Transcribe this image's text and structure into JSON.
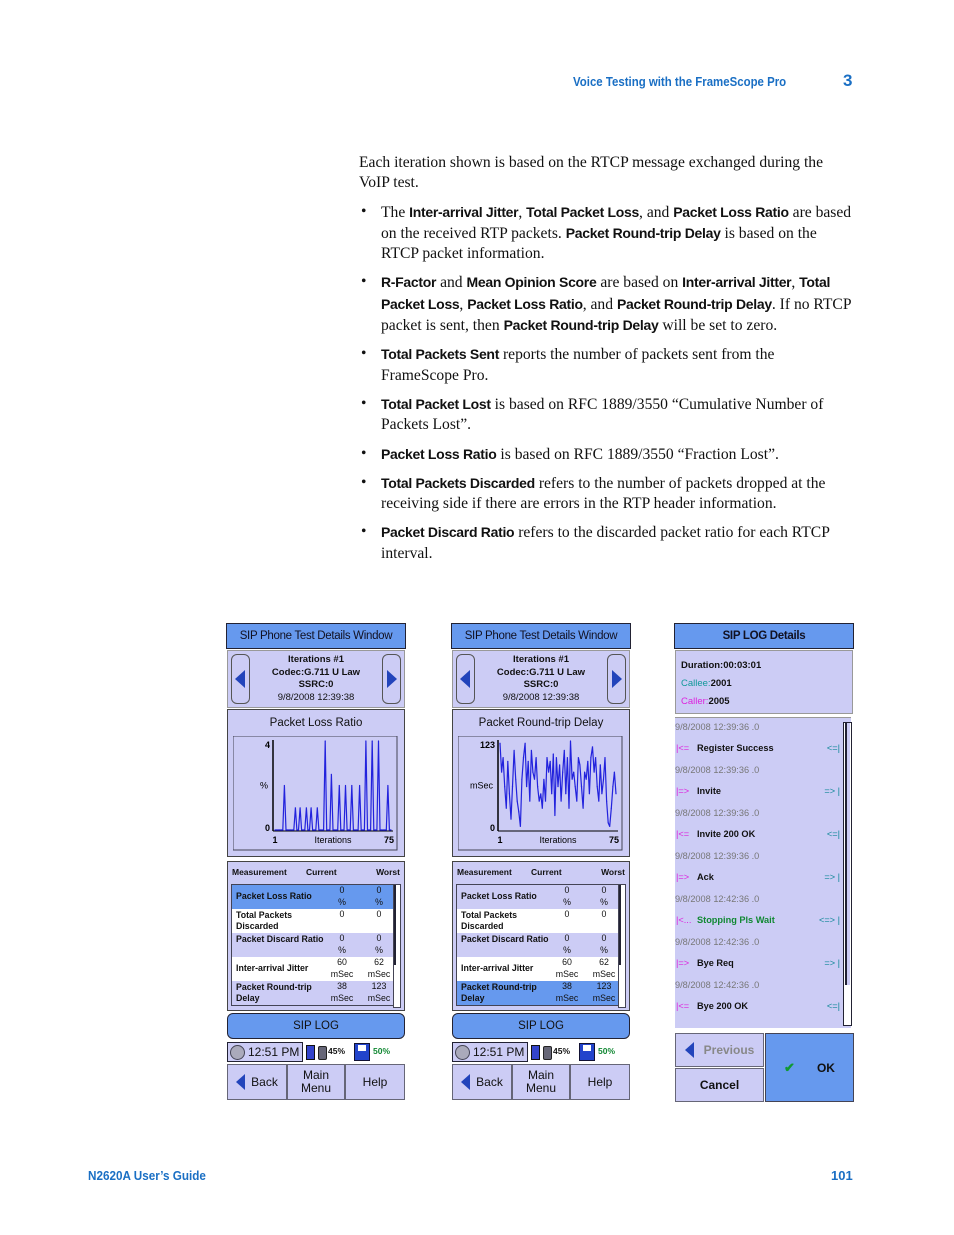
{
  "header": {
    "section_title": "Voice Testing with the FrameScope Pro",
    "chapter_number": "3"
  },
  "body": {
    "intro": "Each iteration shown is based on the RTCP message exchanged during the VoIP test.",
    "bullets": [
      [
        {
          "t": "The "
        },
        {
          "b": "Inter-arrival Jitter"
        },
        {
          "t": ", "
        },
        {
          "b": "Total Packet Loss"
        },
        {
          "t": ", and "
        },
        {
          "b": "Packet Loss Ratio"
        },
        {
          "t": " are based on the received RTP packets. "
        },
        {
          "b": "Packet Round-trip Delay"
        },
        {
          "t": " is based on the RTCP packet information."
        }
      ],
      [
        {
          "b": "R-Factor"
        },
        {
          "t": " and "
        },
        {
          "b": "Mean Opinion Score"
        },
        {
          "t": " are based on "
        },
        {
          "b": "Inter-arrival Jitter"
        },
        {
          "t": ", "
        },
        {
          "b": "Total Packet Loss"
        },
        {
          "t": ", "
        },
        {
          "b": "Packet Loss Ratio"
        },
        {
          "t": ", and "
        },
        {
          "b": "Packet Round-trip Delay"
        },
        {
          "t": ". If no RTCP packet is sent, then "
        },
        {
          "b": "Packet Round-trip Delay"
        },
        {
          "t": " will be set to zero."
        }
      ],
      [
        {
          "b": "Total Packets Sent"
        },
        {
          "t": " reports the number of packets sent from the FrameScope Pro."
        }
      ],
      [
        {
          "b": "Total Packet Lost"
        },
        {
          "t": " is based on RFC 1889/3550 “Cumulative Number of Packets Lost”."
        }
      ],
      [
        {
          "b": "Packet Loss Ratio"
        },
        {
          "t": " is based on RFC 1889/3550 “Fraction Lost”."
        }
      ],
      [
        {
          "b": "Total Packets Discarded"
        },
        {
          "t": " refers to the number of packets dropped at the receiving side if there are errors in the RTP header information."
        }
      ],
      [
        {
          "b": "Packet Discard Ratio"
        },
        {
          "t": " refers to the discarded packet ratio for each RTCP interval."
        }
      ]
    ],
    "bullet_glyph": "•"
  },
  "screens": [
    {
      "title": "SIP Phone Test Details Window",
      "info": {
        "iteration": "Iterations #1",
        "codec": "Codec:G.711 U Law",
        "ssrc": "SSRC:0",
        "timestamp": "9/8/2008 12:39:38"
      },
      "chart_title": "Packet Loss Ratio",
      "table": {
        "headers": {
          "measurement": "Measurement",
          "current": "Current",
          "worst": "Worst"
        },
        "selected_row": 0,
        "rows": [
          {
            "m": "Packet Loss Ratio",
            "cur": "0",
            "cur_u": "%",
            "wor": "0",
            "wor_u": "%"
          },
          {
            "m": "Total Packets Discarded",
            "cur": "0",
            "cur_u": "",
            "wor": "0",
            "wor_u": ""
          },
          {
            "m": "Packet Discard Ratio",
            "cur": "0",
            "cur_u": "%",
            "wor": "0",
            "wor_u": "%"
          },
          {
            "m": "Inter-arrival Jitter",
            "cur": "60",
            "cur_u": "mSec",
            "wor": "62",
            "wor_u": "mSec"
          },
          {
            "m": "Packet Round-trip Delay",
            "cur": "38",
            "cur_u": "mSec",
            "wor": "123",
            "wor_u": "mSec"
          }
        ]
      },
      "sip_log_label": "SIP LOG",
      "status": {
        "time": "12:51 PM",
        "battery": "45%",
        "storage": "50%",
        "storage_icon_label": "CF"
      },
      "buttons": {
        "back": "Back",
        "main_menu": "Main Menu",
        "help": "Help"
      }
    },
    {
      "title": "SIP Phone Test Details Window",
      "info": {
        "iteration": "Iterations #1",
        "codec": "Codec:G.711 U Law",
        "ssrc": "SSRC:0",
        "timestamp": "9/8/2008 12:39:38"
      },
      "chart_title": "Packet Round-trip Delay",
      "table": {
        "headers": {
          "measurement": "Measurement",
          "current": "Current",
          "worst": "Worst"
        },
        "selected_row": 4,
        "rows": [
          {
            "m": "Packet Loss Ratio",
            "cur": "0",
            "cur_u": "%",
            "wor": "0",
            "wor_u": "%"
          },
          {
            "m": "Total Packets Discarded",
            "cur": "0",
            "cur_u": "",
            "wor": "0",
            "wor_u": ""
          },
          {
            "m": "Packet Discard Ratio",
            "cur": "0",
            "cur_u": "%",
            "wor": "0",
            "wor_u": "%"
          },
          {
            "m": "Inter-arrival Jitter",
            "cur": "60",
            "cur_u": "mSec",
            "wor": "62",
            "wor_u": "mSec"
          },
          {
            "m": "Packet Round-trip Delay",
            "cur": "38",
            "cur_u": "mSec",
            "wor": "123",
            "wor_u": "mSec"
          }
        ]
      },
      "sip_log_label": "SIP LOG",
      "status": {
        "time": "12:51 PM",
        "battery": "45%",
        "storage": "50%",
        "storage_icon_label": "CF"
      },
      "buttons": {
        "back": "Back",
        "main_menu": "Main Menu",
        "help": "Help"
      }
    }
  ],
  "sip_log": {
    "title": "SIP LOG Details",
    "duration": "Duration:00:03:01",
    "callee_label": "Callee:",
    "callee": "2001",
    "caller_label": "Caller:",
    "caller": "2005",
    "entries": [
      {
        "ts": "9/8/2008 12:39:36 .0",
        "left": "|<=",
        "msg": "Register Success",
        "right": "<=|",
        "msg_color": "#111111"
      },
      {
        "ts": "9/8/2008 12:39:36 .0",
        "left": "|=>",
        "msg": "Invite",
        "right": "=> |",
        "msg_color": "#111111"
      },
      {
        "ts": "9/8/2008 12:39:36 .0",
        "left": "|<=",
        "msg": "Invite 200 OK",
        "right": "<=|",
        "msg_color": "#111111"
      },
      {
        "ts": "9/8/2008 12:39:36 .0",
        "left": "|=>",
        "msg": "Ack",
        "right": "=> |",
        "msg_color": "#111111"
      },
      {
        "ts": "9/8/2008 12:42:36 .0",
        "left": "|<...",
        "msg": "Stopping Pls Wait",
        "right": "<=> |",
        "msg_color": "#118833"
      },
      {
        "ts": "9/8/2008 12:42:36 .0",
        "left": "|=>",
        "msg": "Bye Req",
        "right": "=> |",
        "msg_color": "#111111"
      },
      {
        "ts": "9/8/2008 12:42:36 .0",
        "left": "|<=",
        "msg": "Bye 200 OK",
        "right": "<=|",
        "msg_color": "#111111"
      }
    ],
    "buttons": {
      "previous": "Previous",
      "cancel": "Cancel",
      "ok": "OK",
      "ok_glyph": "✔"
    }
  },
  "colors": {
    "accent_blue": "#1a6fc4",
    "screen_bg": "#ccccf5",
    "selection": "#6699ee",
    "plot_line": "#2222dd"
  },
  "footer": {
    "guide": "N2620A User’s Guide",
    "page": "101"
  },
  "chart_data": [
    {
      "type": "line",
      "title": "Packet Loss Ratio",
      "xlabel": "Iterations",
      "ylabel": "%",
      "xlim": [
        1,
        75
      ],
      "ylim": [
        0,
        4
      ],
      "x_ticks": [
        "1",
        "75"
      ],
      "y_ticks": [
        "0",
        "4"
      ],
      "grid": false,
      "series": [
        {
          "name": "Packet Loss Ratio",
          "values": [
            0,
            0,
            0,
            0,
            0,
            0,
            2,
            0,
            0,
            0,
            0,
            0,
            0,
            1,
            0,
            0,
            1,
            0,
            0,
            0,
            1,
            0,
            0,
            1,
            0,
            0,
            0,
            1,
            0,
            0,
            0,
            0,
            4,
            0,
            0,
            0,
            2.5,
            0,
            0,
            0,
            0,
            2,
            0,
            0,
            0,
            2,
            0,
            0,
            0,
            2,
            0,
            0,
            0,
            0,
            2,
            0,
            0,
            0,
            4,
            0,
            0,
            0,
            4,
            0,
            0,
            0,
            4,
            0,
            0,
            0,
            0,
            0,
            2,
            0,
            0
          ]
        }
      ]
    },
    {
      "type": "line",
      "title": "Packet Round-trip Delay",
      "xlabel": "Iterations",
      "ylabel": "mSec",
      "xlim": [
        1,
        75
      ],
      "ylim": [
        0,
        123
      ],
      "x_ticks": [
        "1",
        "75"
      ],
      "y_ticks": [
        "0",
        "123"
      ],
      "grid": false,
      "series": [
        {
          "name": "Packet Round-trip Delay",
          "values": [
            120,
            80,
            100,
            60,
            30,
            95,
            50,
            15,
            60,
            110,
            70,
            40,
            25,
            5,
            70,
            100,
            120,
            60,
            95,
            40,
            110,
            80,
            70,
            100,
            60,
            40,
            50,
            30,
            70,
            40,
            100,
            80,
            95,
            50,
            105,
            20,
            100,
            60,
            90,
            40,
            80,
            110,
            50,
            100,
            30,
            123,
            70,
            80,
            60,
            40,
            100,
            90,
            60,
            30,
            80,
            70,
            95,
            50,
            100,
            115,
            80,
            100,
            60,
            40,
            90,
            50,
            70,
            100,
            40,
            10,
            5,
            30,
            60,
            80,
            50
          ]
        }
      ]
    }
  ]
}
